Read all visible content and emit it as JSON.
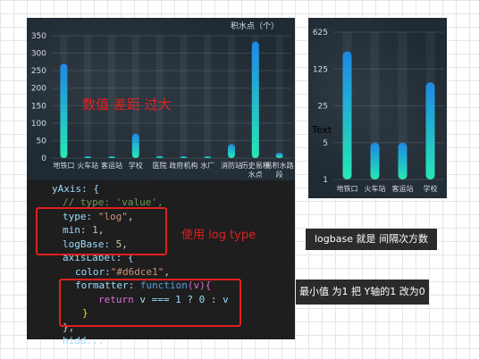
{
  "left_chart": {
    "unit_label": "积水点（个）",
    "y_ticks": [
      "350",
      "300",
      "250",
      "200",
      "150",
      "100",
      "50",
      "0"
    ],
    "annotation": "数值 差距 过大"
  },
  "right_chart": {
    "y_ticks": [
      "625",
      "125",
      "25",
      "5",
      "1"
    ],
    "float_text": "Text"
  },
  "code": {
    "l1": "yAxis: {",
    "l2": "// type: 'value',",
    "l3_key": "type: ",
    "l3_val": "\"log\"",
    "l4_key": "min: ",
    "l4_val": "1",
    "l5_key": "logBase: ",
    "l5_val": "5",
    "l6": "axisLabel: {",
    "l7_key": "color:",
    "l7_val": "\"#d6dce1\"",
    "l8_key": "formatter: ",
    "l8_fn": "function",
    "l8_arg": "(v){",
    "l9_kw": "return",
    "l9_rest": " v === 1 ? 0 : v",
    "l10": "}",
    "l11": "},",
    "l12": "hidd..."
  },
  "annotations": {
    "use_log": "使用    log    type",
    "logbase_note": "logbase   就是  间隔次方数",
    "min_note": "最小值  为1   把 Y轴的1 改为0"
  },
  "colors": {
    "bar_top": "#1e88e5",
    "bar_bottom": "#26e8b5",
    "highlight": "#e02020"
  },
  "chart_data": [
    {
      "type": "bar",
      "categories": [
        "地铁口",
        "火车站",
        "客运站",
        "学校",
        "医院",
        "政府机构",
        "水厂",
        "消防站",
        "历史易积水点",
        "易积水路段"
      ],
      "values": [
        270,
        5,
        5,
        70,
        6,
        5,
        5,
        40,
        333,
        15
      ],
      "ylabel": "积水点（个）",
      "ylim": [
        0,
        350
      ]
    },
    {
      "type": "bar",
      "categories": [
        "地铁口",
        "火车站",
        "客运站",
        "学校"
      ],
      "values": [
        270,
        5,
        5,
        70
      ],
      "yscale": "log",
      "logBase": 5,
      "ylim": [
        1,
        625
      ]
    }
  ]
}
